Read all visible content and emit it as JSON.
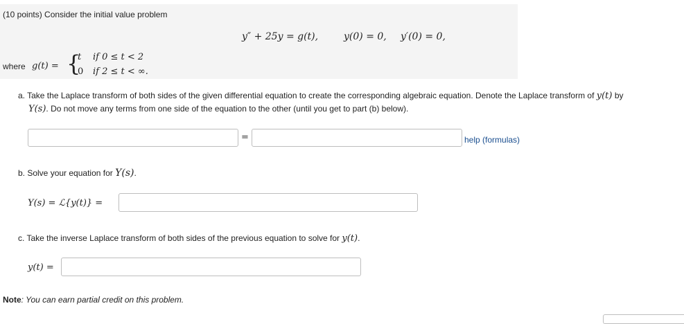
{
  "problem": {
    "points": "(10 points) Consider the initial value problem",
    "equation": "y″ + 25y = g(t),",
    "ic1": "y(0) = 0,",
    "ic2": "y′(0) = 0,",
    "where_label": "where",
    "g_lhs": "g(t) =",
    "case1_value": "t",
    "case1_cond": "if 0 ≤ t < 2",
    "case2_value": "0",
    "case2_cond": "if 2 ≤ t < ∞."
  },
  "part_a": {
    "text1": "a. Take the Laplace transform of both sides of the given differential equation to create the corresponding algebraic equation. Denote the Laplace transform of",
    "y_of_t": "y(t)",
    "by": "by",
    "Y_of_s": "Y(s)",
    "text2": ". Do not move any terms from one side of the equation to the other (until you get to part (b) below).",
    "equals": "=",
    "left_input_value": "",
    "right_input_value": "",
    "help_link": "help (formulas)"
  },
  "part_b": {
    "text": "b. Solve your equation for",
    "Y_of_s": "Y(s)",
    "period": ".",
    "lhs": "Y(s) = ℒ{y(t)} =",
    "input_value": ""
  },
  "part_c": {
    "text": "c. Take the inverse Laplace transform of both sides of the previous equation to solve for",
    "y_of_t": "y(t)",
    "period": ".",
    "lhs": "y(t) =",
    "input_value": ""
  },
  "note": {
    "label": "Note",
    "text": ": You can earn partial credit on this problem."
  }
}
